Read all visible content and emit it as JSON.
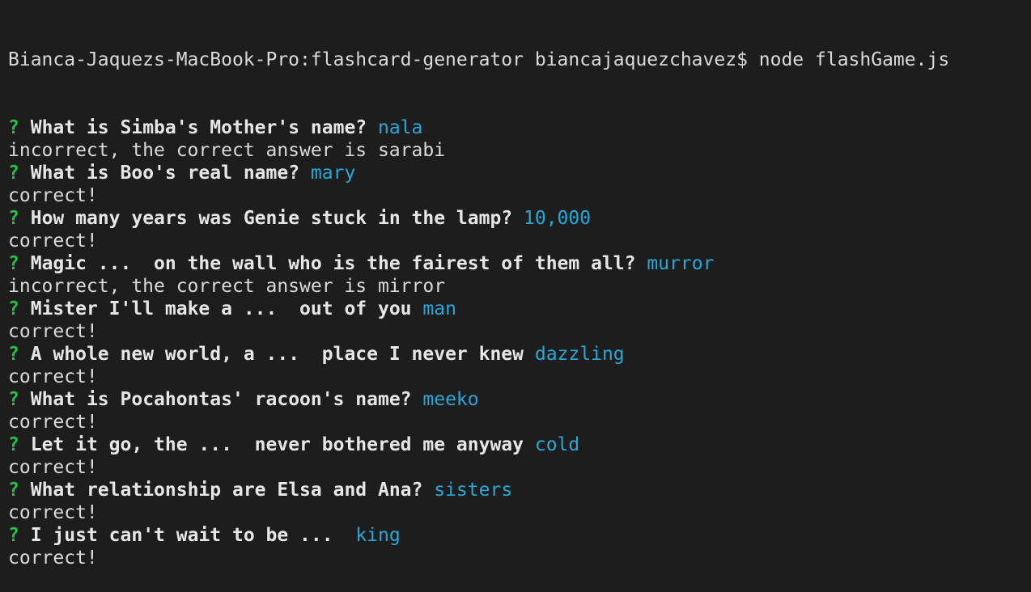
{
  "terminal": {
    "prompt": "Bianca-Jaquezs-MacBook-Pro:flashcard-generator biancajaquezchavez$ node flashGame.js",
    "question_mark": "?",
    "entries": [
      {
        "question": "What is Simba's Mother's name?",
        "answer": "nala",
        "result": "incorrect, the correct answer is sarabi"
      },
      {
        "question": "What is Boo's real name?",
        "answer": "mary",
        "result": "correct!"
      },
      {
        "question": "How many years was Genie stuck in the lamp?",
        "answer": "10,000",
        "result": "correct!"
      },
      {
        "question": "Magic ...  on the wall who is the fairest of them all?",
        "answer": "murror",
        "result": "incorrect, the correct answer is mirror"
      },
      {
        "question": "Mister I'll make a ...  out of you",
        "answer": "man",
        "result": "correct!"
      },
      {
        "question": "A whole new world, a ...  place I never knew",
        "answer": "dazzling",
        "result": "correct!"
      },
      {
        "question": "What is Pocahontas' racoon's name?",
        "answer": "meeko",
        "result": "correct!"
      },
      {
        "question": "Let it go, the ...  never bothered me anyway",
        "answer": "cold",
        "result": "correct!"
      },
      {
        "question": "What relationship are Elsa and Ana?",
        "answer": "sisters",
        "result": "correct!"
      },
      {
        "question": "I just can't wait to be ... ",
        "answer": "king",
        "result": "correct!"
      }
    ],
    "colors": {
      "background": "#1d1d1d",
      "text": "#d9d9d9",
      "question_mark": "#2bbf4a",
      "answer": "#2aa7d6"
    }
  }
}
